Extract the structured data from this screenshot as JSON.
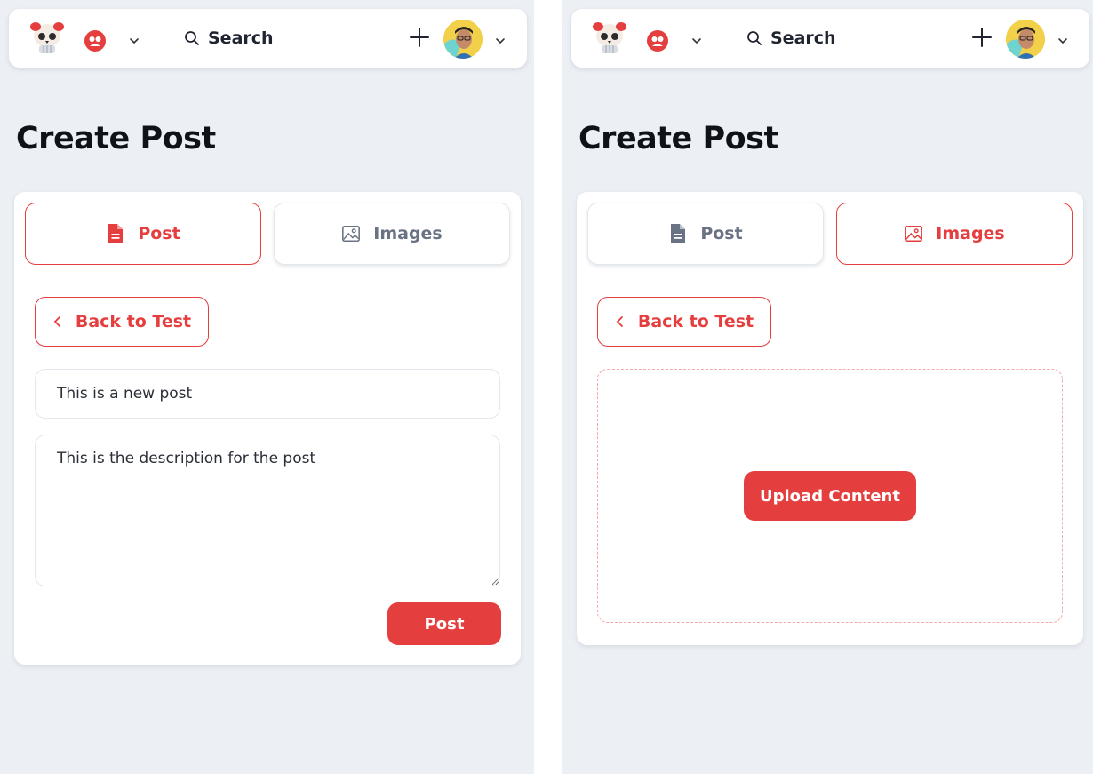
{
  "colors": {
    "accent": "#e53e3e",
    "page_bg": "#ecf0f5",
    "muted": "#6a7384"
  },
  "nav": {
    "search_label": "Search",
    "icons": [
      "skull-logo-icon",
      "community-icon",
      "chevron-down-icon",
      "search-icon",
      "plus-icon",
      "user-avatar"
    ]
  },
  "left": {
    "page_title": "Create Post",
    "tabs": [
      {
        "label": "Post",
        "icon": "document-icon",
        "active": true
      },
      {
        "label": "Images",
        "icon": "image-icon",
        "active": false
      }
    ],
    "back_label": "Back to Test",
    "title_value": "This is a new post",
    "description_value": "This is the description for the post",
    "submit_label": "Post"
  },
  "right": {
    "page_title": "Create Post",
    "tabs": [
      {
        "label": "Post",
        "icon": "document-icon",
        "active": false
      },
      {
        "label": "Images",
        "icon": "image-icon",
        "active": true
      }
    ],
    "back_label": "Back to Test",
    "upload_label": "Upload Content"
  }
}
